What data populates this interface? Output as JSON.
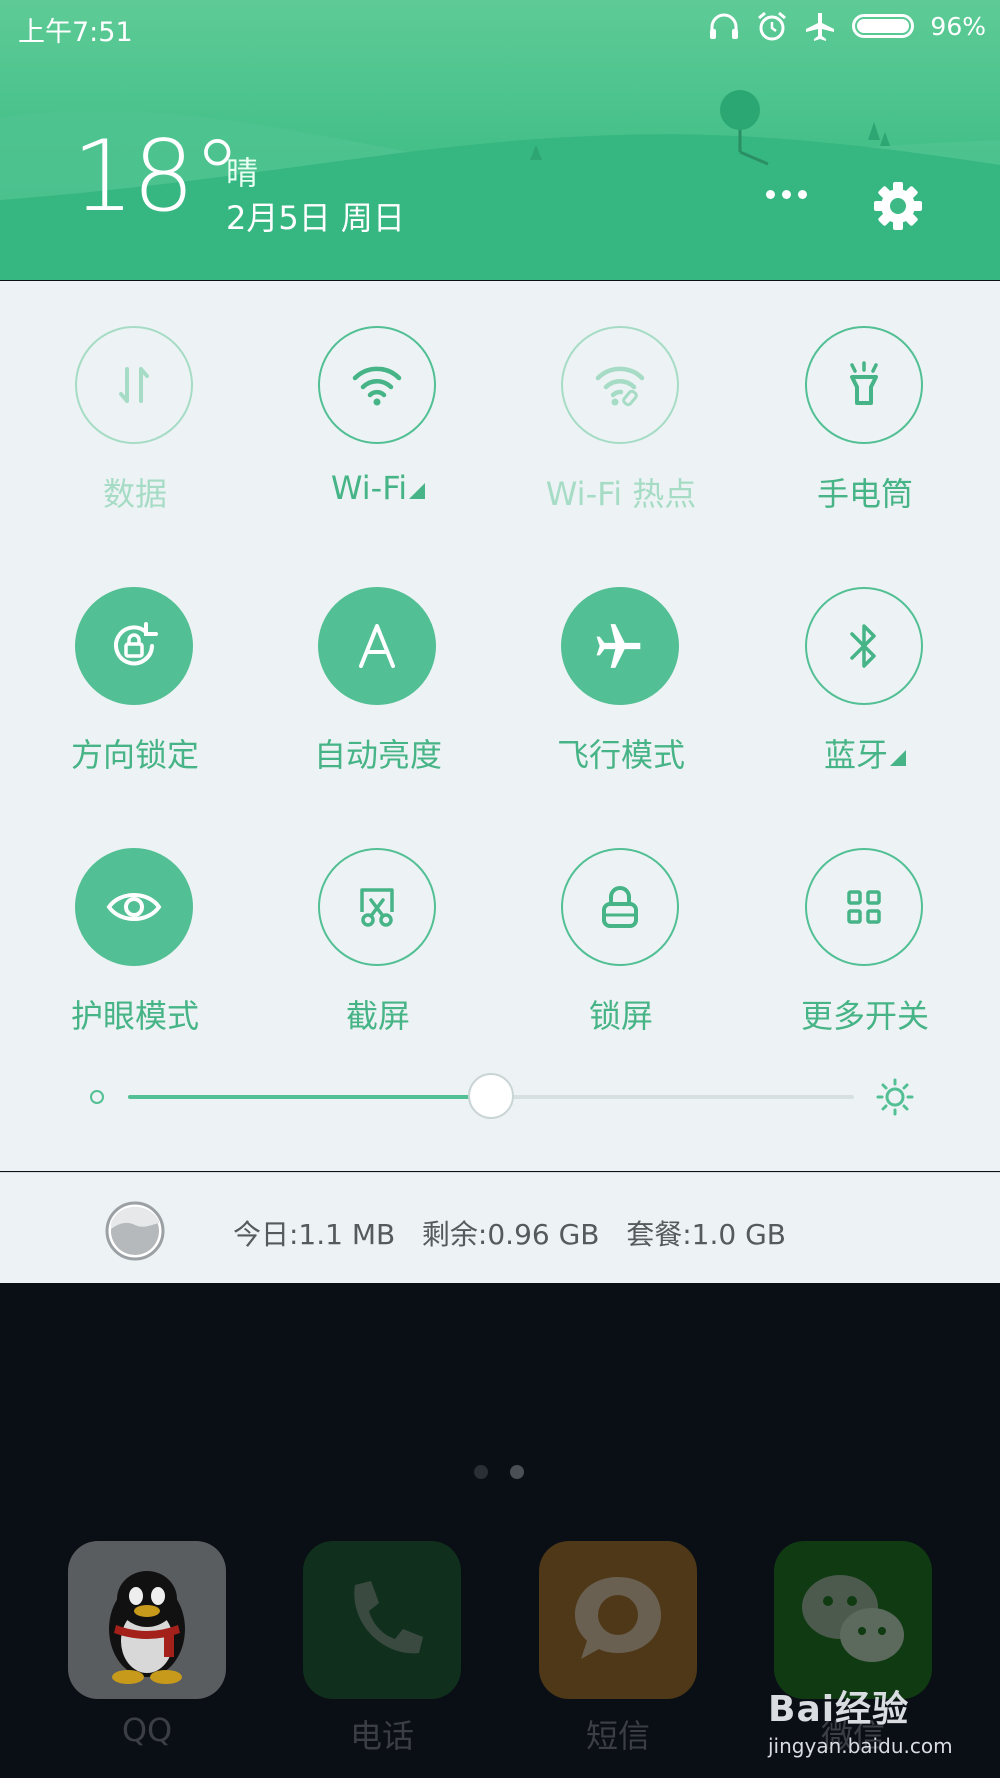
{
  "status_bar": {
    "time": "上午7:51",
    "battery_percent": "96%",
    "battery_level": 0.96,
    "icons": [
      "headset-icon",
      "alarm-icon",
      "airplane-mode-icon",
      "battery-icon"
    ]
  },
  "weather": {
    "temperature": "18°",
    "condition": "晴",
    "date": "2月5日 周日"
  },
  "header_actions": {
    "more_icon": "more-dots-icon",
    "settings_icon": "gear-icon"
  },
  "toggles": [
    {
      "label": "数据",
      "icon": "mobile-data-icon",
      "state": "disabled"
    },
    {
      "label": "Wi-Fi",
      "icon": "wifi-icon",
      "state": "off",
      "expandable": true
    },
    {
      "label": "Wi-Fi 热点",
      "icon": "hotspot-icon",
      "state": "disabled"
    },
    {
      "label": "手电筒",
      "icon": "flashlight-icon",
      "state": "off"
    },
    {
      "label": "方向锁定",
      "icon": "rotation-lock-icon",
      "state": "on"
    },
    {
      "label": "自动亮度",
      "icon": "auto-brightness-icon",
      "state": "on"
    },
    {
      "label": "飞行模式",
      "icon": "airplane-icon",
      "state": "on"
    },
    {
      "label": "蓝牙",
      "icon": "bluetooth-icon",
      "state": "off",
      "expandable": true
    },
    {
      "label": "护眼模式",
      "icon": "eye-icon",
      "state": "on"
    },
    {
      "label": "截屏",
      "icon": "screenshot-icon",
      "state": "off"
    },
    {
      "label": "锁屏",
      "icon": "lock-icon",
      "state": "off"
    },
    {
      "label": "更多开关",
      "icon": "grid-icon",
      "state": "off"
    }
  ],
  "brightness": {
    "level": 0.5,
    "min_icon": "brightness-low-icon",
    "max_icon": "brightness-high-icon"
  },
  "data_usage": {
    "text": "今日:1.1 MB   剩余:0.96 GB   套餐:1.0 GB"
  },
  "dock": [
    {
      "label": "QQ",
      "icon": "qq-penguin-icon"
    },
    {
      "label": "电话",
      "icon": "phone-icon"
    },
    {
      "label": "短信",
      "icon": "message-icon"
    },
    {
      "label": "微信",
      "icon": "wechat-icon"
    }
  ],
  "watermark": {
    "brand": "Bai经验",
    "url": "jingyan.baidu.com"
  },
  "colors": {
    "accent": "#52bf94",
    "header_green": "#44bf88",
    "panel_bg": "#edf3f4"
  }
}
